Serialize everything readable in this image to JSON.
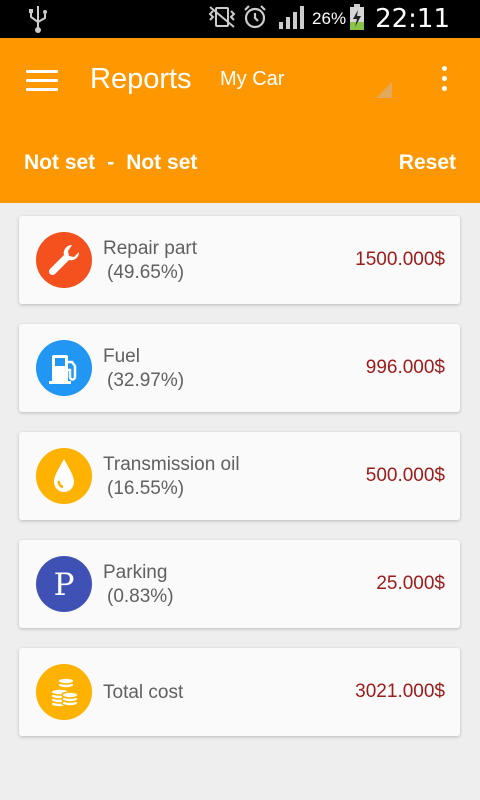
{
  "status_bar": {
    "battery_percent": "26%",
    "time": "22:11",
    "icons": [
      "usb-icon",
      "vibrate-icon",
      "alarm-icon",
      "signal-icon",
      "battery-charging-icon"
    ]
  },
  "app_bar": {
    "title": "Reports",
    "car_selector": "My Car",
    "date_from": "Not set",
    "date_separator": "-",
    "date_to": "Not set",
    "reset_label": "Reset"
  },
  "items": [
    {
      "name": "Repair part",
      "percent": "(49.65%)",
      "amount": "1500.000$",
      "icon": "wrench-icon",
      "color": "#f4511e"
    },
    {
      "name": "Fuel",
      "percent": "(32.97%)",
      "amount": "996.000$",
      "icon": "fuel-pump-icon",
      "color": "#2196f3"
    },
    {
      "name": "Transmission oil",
      "percent": "(16.55%)",
      "amount": "500.000$",
      "icon": "oil-drop-icon",
      "color": "#ffb300"
    },
    {
      "name": "Parking",
      "percent": "(0.83%)",
      "amount": "25.000$",
      "icon": "parking-icon",
      "color": "#3f51b5"
    }
  ],
  "total": {
    "name": "Total cost",
    "amount": "3021.000$",
    "icon": "coins-icon",
    "color": "#ffb300"
  },
  "colors": {
    "accent": "#ff9800",
    "amount_text": "#9c1a1a",
    "background": "#eeeeee"
  }
}
